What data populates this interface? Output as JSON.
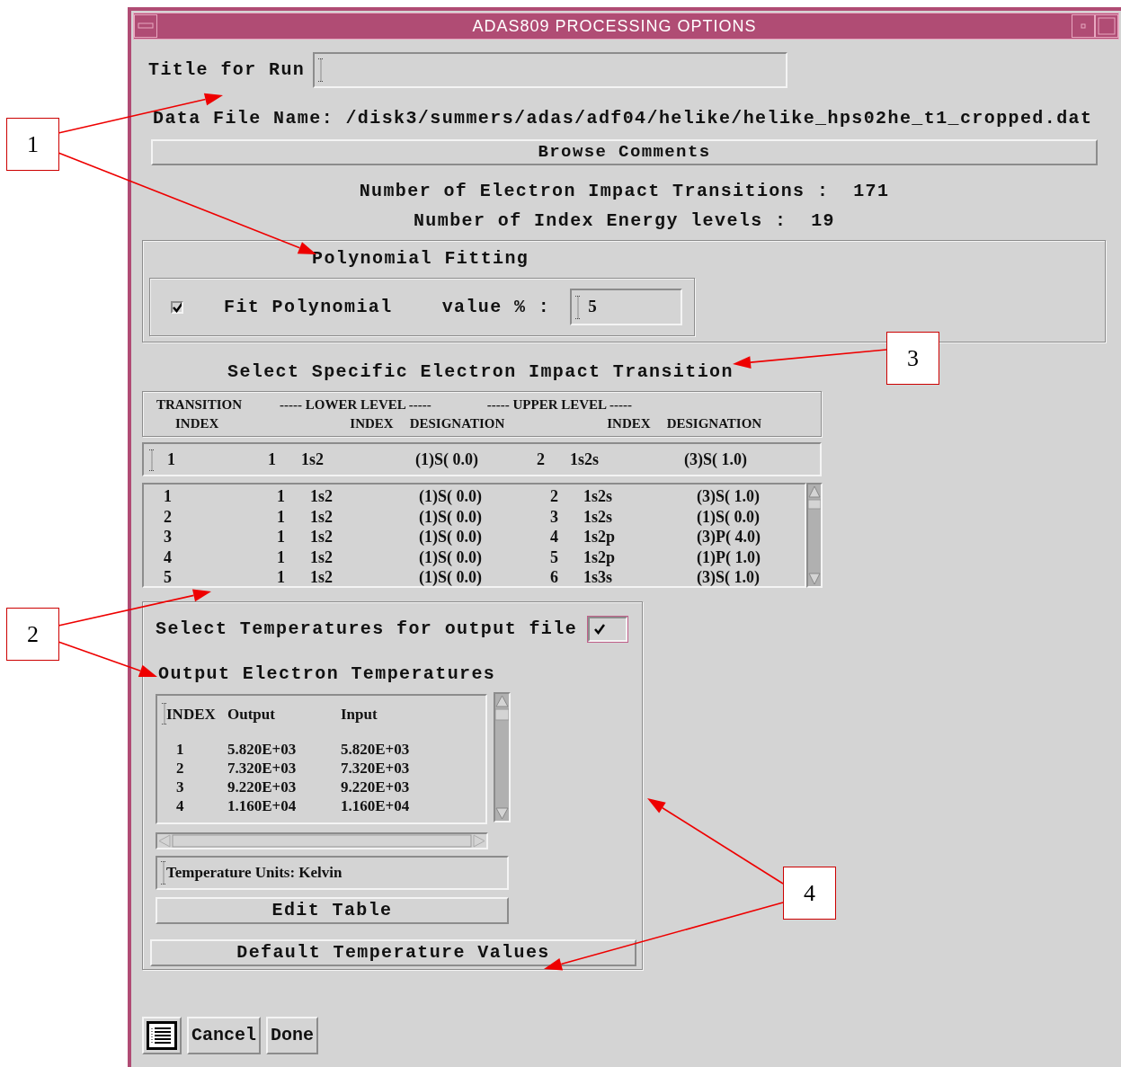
{
  "window": {
    "title": "ADAS809 PROCESSING OPTIONS"
  },
  "run_title": {
    "label": "Title for Run"
  },
  "data_file": {
    "label": "Data File Name:",
    "path": "/disk3/summers/adas/adf04/helike/helike_hps02he_t1_cropped.dat"
  },
  "browse_button": "Browse Comments",
  "counts": [
    {
      "label": "Number of Electron Impact Transitions :",
      "value": "171"
    },
    {
      "label": "Number of Index Energy levels :",
      "value": "19"
    }
  ],
  "polynomial": {
    "title": "Polynomial Fitting",
    "checkbox_label": "Fit Polynomial",
    "checked": true,
    "value_label": "value % :",
    "value": "5"
  },
  "transition": {
    "title": "Select Specific Electron Impact Transition",
    "header_line_1": [
      "TRANSITION",
      "----- LOWER LEVEL -----",
      "----- UPPER LEVEL -----"
    ],
    "header_line_2": [
      "INDEX",
      "INDEX",
      "DESIGNATION",
      "INDEX",
      "DESIGNATION"
    ],
    "selected_row": [
      "1",
      "1",
      "1s2",
      "(1)S( 0.0)",
      "2",
      "1s2s",
      "(3)S( 1.0)"
    ],
    "rows": [
      [
        "1",
        "1",
        "1s2",
        "(1)S( 0.0)",
        "2",
        "1s2s",
        "(3)S( 1.0)"
      ],
      [
        "2",
        "1",
        "1s2",
        "(1)S( 0.0)",
        "3",
        "1s2s",
        "(1)S( 0.0)"
      ],
      [
        "3",
        "1",
        "1s2",
        "(1)S( 0.0)",
        "4",
        "1s2p",
        "(3)P( 4.0)"
      ],
      [
        "4",
        "1",
        "1s2",
        "(1)S( 0.0)",
        "5",
        "1s2p",
        "(1)P( 1.0)"
      ],
      [
        "5",
        "1",
        "1s2",
        "(1)S( 0.0)",
        "6",
        "1s3s",
        "(3)S( 1.0)"
      ]
    ]
  },
  "temperatures": {
    "title": "Select Temperatures for output file",
    "checked": true,
    "subtitle": "Output Electron Temperatures",
    "columns": [
      "INDEX",
      "Output",
      "Input"
    ],
    "rows": [
      [
        "1",
        "5.820E+03",
        "5.820E+03"
      ],
      [
        "2",
        "7.320E+03",
        "7.320E+03"
      ],
      [
        "3",
        "9.220E+03",
        "9.220E+03"
      ],
      [
        "4",
        "1.160E+04",
        "1.160E+04"
      ]
    ],
    "units": "Temperature Units: Kelvin",
    "edit_button": "Edit Table",
    "default_button": "Default Temperature Values"
  },
  "buttons": [
    "Cancel",
    "Done"
  ],
  "callouts": [
    {
      "label": "1"
    },
    {
      "label": "2"
    },
    {
      "label": "3"
    },
    {
      "label": "4"
    }
  ]
}
